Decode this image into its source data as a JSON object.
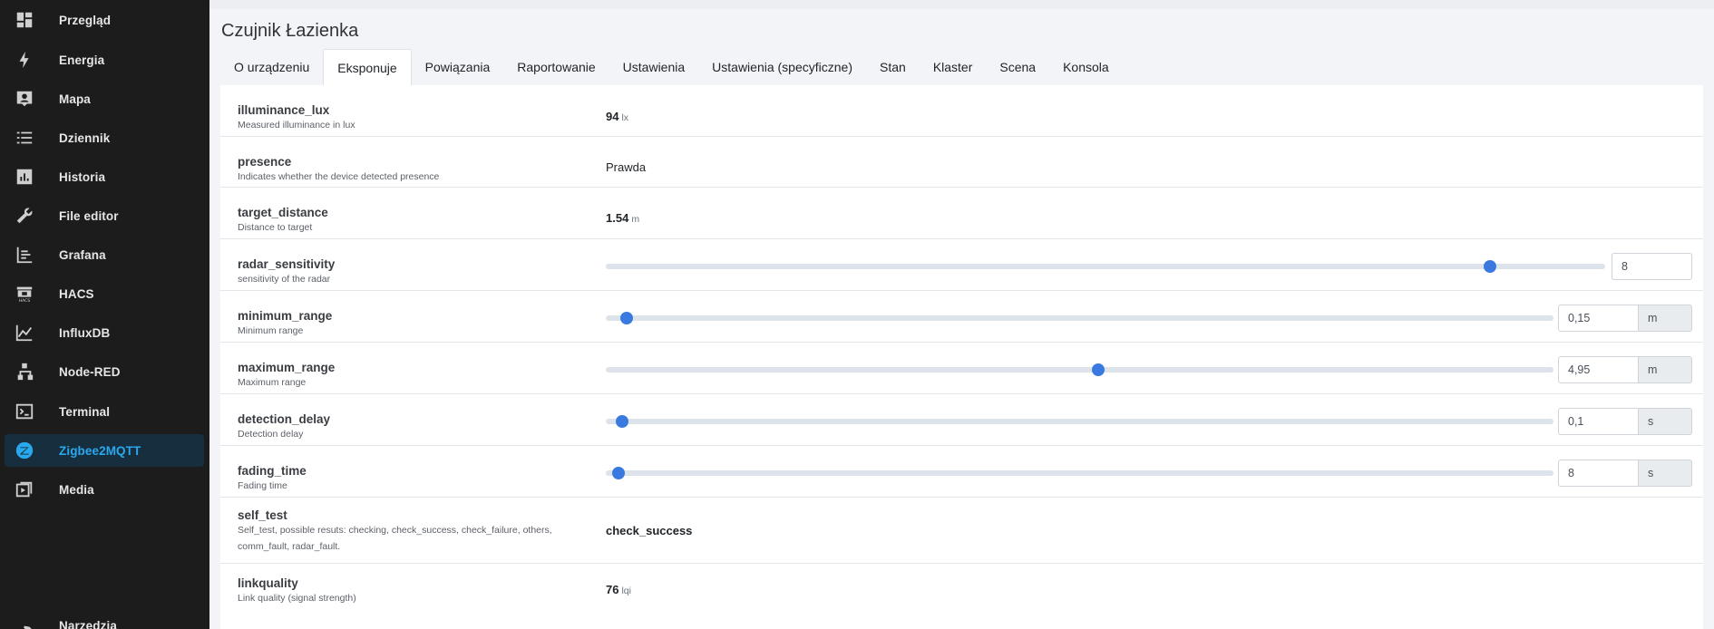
{
  "sidebar": {
    "items": [
      {
        "label": "Przegląd",
        "icon": "dashboard-icon"
      },
      {
        "label": "Energia",
        "icon": "lightning-icon"
      },
      {
        "label": "Mapa",
        "icon": "map-account-icon"
      },
      {
        "label": "Dziennik",
        "icon": "list-icon"
      },
      {
        "label": "Historia",
        "icon": "chart-box-icon"
      },
      {
        "label": "File editor",
        "icon": "wrench-icon"
      },
      {
        "label": "Grafana",
        "icon": "chart-timeline-icon"
      },
      {
        "label": "HACS",
        "icon": "hacs-icon"
      },
      {
        "label": "InfluxDB",
        "icon": "chart-areaspline-icon"
      },
      {
        "label": "Node-RED",
        "icon": "sitemap-icon"
      },
      {
        "label": "Terminal",
        "icon": "console-icon"
      },
      {
        "label": "Zigbee2MQTT",
        "icon": "zigbee-icon"
      },
      {
        "label": "Media",
        "icon": "play-box-icon"
      },
      {
        "label": "Narzędzia deweloperskie",
        "icon": "hammer-icon"
      }
    ],
    "active_item": "Zigbee2MQTT",
    "accent_color": "#2aa8ee"
  },
  "page": {
    "title": "Czujnik Łazienka",
    "tabs": [
      "O urządzeniu",
      "Eksponuje",
      "Powiązania",
      "Raportowanie",
      "Ustawienia",
      "Ustawienia (specyficzne)",
      "Stan",
      "Klaster",
      "Scena",
      "Konsola"
    ],
    "active_tab": "Eksponuje"
  },
  "exposes": {
    "illuminance_lux": {
      "name": "illuminance_lux",
      "description": "Measured illuminance in lux",
      "value": "94",
      "unit": "lx"
    },
    "presence": {
      "name": "presence",
      "description": "Indicates whether the device detected presence",
      "value": "Prawda"
    },
    "target_distance": {
      "name": "target_distance",
      "description": "Distance to target",
      "value": "1.54",
      "unit": "m"
    },
    "radar_sensitivity": {
      "name": "radar_sensitivity",
      "description": "sensitivity of the radar",
      "value": "8",
      "slider_fraction": 0.885
    },
    "minimum_range": {
      "name": "minimum_range",
      "description": "Minimum range",
      "value": "0,15",
      "unit": "m",
      "slider_fraction": 0.022
    },
    "maximum_range": {
      "name": "maximum_range",
      "description": "Maximum range",
      "value": "4,95",
      "unit": "m",
      "slider_fraction": 0.52
    },
    "detection_delay": {
      "name": "detection_delay",
      "description": "Detection delay",
      "value": "0,1",
      "unit": "s",
      "slider_fraction": 0.017
    },
    "fading_time": {
      "name": "fading_time",
      "description": "Fading time",
      "value": "8",
      "unit": "s",
      "slider_fraction": 0.013
    },
    "self_test": {
      "name": "self_test",
      "description_line1": "Self_test, possible resuts: checking, check_success, check_failure, others,",
      "description_line2": "comm_fault, radar_fault.",
      "value": "check_success"
    },
    "linkquality": {
      "name": "linkquality",
      "description": "Link quality (signal strength)",
      "value": "76",
      "unit": "lqi"
    }
  },
  "colors": {
    "slider_thumb": "#3a7ae0",
    "slider_track": "#dde3ea",
    "sidebar_bg": "#1c1c1c"
  }
}
